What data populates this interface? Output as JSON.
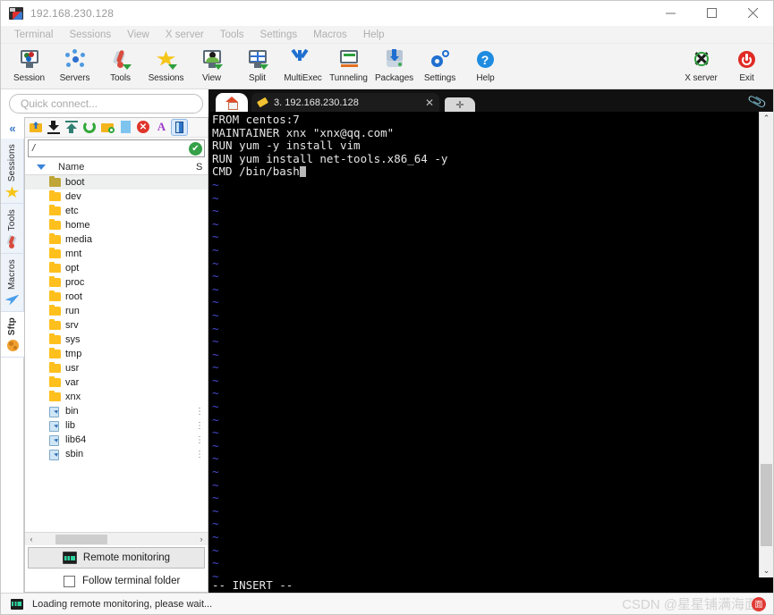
{
  "window": {
    "title": "192.168.230.128",
    "icon": "mobaxterm-icon",
    "minimize": "–",
    "maximize": "☐",
    "close": "✕"
  },
  "menubar": {
    "items": [
      {
        "label": "Terminal"
      },
      {
        "label": "Sessions"
      },
      {
        "label": "View"
      },
      {
        "label": "X server"
      },
      {
        "label": "Tools"
      },
      {
        "label": "Settings"
      },
      {
        "label": "Macros"
      },
      {
        "label": "Help"
      }
    ]
  },
  "toolbar": {
    "left_items": [
      {
        "label": "Session",
        "icon": "session-icon"
      },
      {
        "label": "Servers",
        "icon": "servers-icon"
      },
      {
        "label": "Tools",
        "icon": "tools-icon"
      },
      {
        "label": "Sessions",
        "icon": "sessions-star-icon"
      },
      {
        "label": "View",
        "icon": "view-icon"
      },
      {
        "label": "Split",
        "icon": "split-icon"
      },
      {
        "label": "MultiExec",
        "icon": "multiexec-icon"
      },
      {
        "label": "Tunneling",
        "icon": "tunneling-icon"
      },
      {
        "label": "Packages",
        "icon": "packages-icon"
      },
      {
        "label": "Settings",
        "icon": "settings-gear-icon"
      },
      {
        "label": "Help",
        "icon": "help-question-icon"
      }
    ],
    "right_items": [
      {
        "label": "X server",
        "icon": "xserver-icon"
      },
      {
        "label": "Exit",
        "icon": "exit-power-icon"
      }
    ]
  },
  "sidebar": {
    "quick_connect_placeholder": "Quick connect...",
    "collapse_glyph": "«",
    "vtabs": [
      {
        "label": "Sessions",
        "icon": "star-icon",
        "active": false
      },
      {
        "label": "Tools",
        "icon": "thermometer-icon",
        "active": false
      },
      {
        "label": "Macros",
        "icon": "paperplane-icon",
        "active": false
      },
      {
        "label": "Sftp",
        "icon": "globe-icon",
        "active": true
      }
    ]
  },
  "sftp": {
    "toolbar_icons": [
      "go-up-folder-icon",
      "download-icon",
      "upload-icon",
      "refresh-icon",
      "new-folder-icon",
      "new-file-icon",
      "delete-icon",
      "text-edit-icon",
      "drive-icon"
    ],
    "path_value": "/",
    "path_ok_glyph": "✔",
    "columns": {
      "name": "Name",
      "size": "S"
    },
    "files": [
      {
        "name": "boot",
        "type": "folder",
        "selected": true,
        "size": ""
      },
      {
        "name": "dev",
        "type": "folder",
        "selected": false,
        "size": ""
      },
      {
        "name": "etc",
        "type": "folder",
        "selected": false,
        "size": ""
      },
      {
        "name": "home",
        "type": "folder",
        "selected": false,
        "size": ""
      },
      {
        "name": "media",
        "type": "folder",
        "selected": false,
        "size": ""
      },
      {
        "name": "mnt",
        "type": "folder",
        "selected": false,
        "size": ""
      },
      {
        "name": "opt",
        "type": "folder",
        "selected": false,
        "size": ""
      },
      {
        "name": "proc",
        "type": "folder",
        "selected": false,
        "size": ""
      },
      {
        "name": "root",
        "type": "folder",
        "selected": false,
        "size": ""
      },
      {
        "name": "run",
        "type": "folder",
        "selected": false,
        "size": ""
      },
      {
        "name": "srv",
        "type": "folder",
        "selected": false,
        "size": ""
      },
      {
        "name": "sys",
        "type": "folder",
        "selected": false,
        "size": ""
      },
      {
        "name": "tmp",
        "type": "folder",
        "selected": false,
        "size": ""
      },
      {
        "name": "usr",
        "type": "folder",
        "selected": false,
        "size": ""
      },
      {
        "name": "var",
        "type": "folder",
        "selected": false,
        "size": ""
      },
      {
        "name": "xnx",
        "type": "folder",
        "selected": false,
        "size": ""
      },
      {
        "name": "bin",
        "type": "link",
        "selected": false,
        "size": "⋮"
      },
      {
        "name": "lib",
        "type": "link",
        "selected": false,
        "size": "⋮"
      },
      {
        "name": "lib64",
        "type": "link",
        "selected": false,
        "size": "⋮"
      },
      {
        "name": "sbin",
        "type": "link",
        "selected": false,
        "size": "⋮"
      }
    ],
    "hscroll": {
      "left_glyph": "‹",
      "right_glyph": "›"
    },
    "remote_monitoring_label": "Remote monitoring",
    "follow_terminal_label": "Follow terminal folder",
    "follow_terminal_checked": false
  },
  "tabs": {
    "home_tab_icon": "home-icon",
    "session_tab": {
      "icon": "terminal-key-icon",
      "label": "3. 192.168.230.128",
      "close_glyph": "✕"
    },
    "new_tab_glyph": "✛",
    "clip_icon": "paperclip-icon"
  },
  "terminal": {
    "lines": [
      "FROM centos:7",
      "MAINTAINER xnx \"xnx@qq.com\"",
      "RUN yum -y install vim",
      "RUN yum install net-tools.x86_64 -y",
      "CMD /bin/bash"
    ],
    "tilde_glyph": "~",
    "tilde_count": 31,
    "status_line": "-- INSERT --",
    "scrollbar": {
      "up_glyph": "⌃",
      "down_glyph": "⌄"
    }
  },
  "statusbar": {
    "icon": "remote-monitoring-icon",
    "text": "Loading remote monitoring, please wait...",
    "watermark": "CSDN @星星铺满海面",
    "watermark_badge": "面"
  },
  "colors": {
    "accent_blue": "#1f6fd0",
    "folder_yellow": "#ffc01e",
    "terminal_bg": "#000000",
    "terminal_fg": "#e6e6e6",
    "tilde_blue": "#4a4ad0",
    "ok_green": "#35a048",
    "exit_red": "#e03a34"
  }
}
